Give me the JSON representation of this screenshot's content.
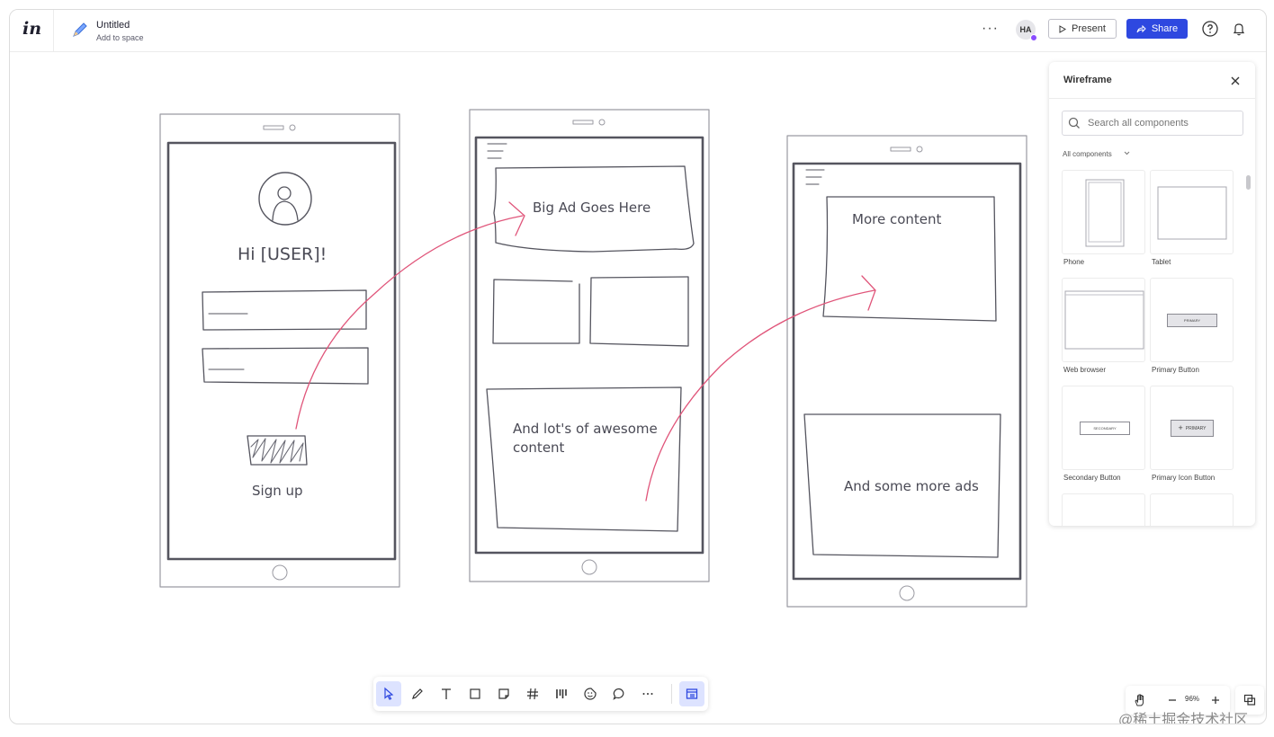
{
  "app": {
    "logo": "in",
    "doc_title": "Untitled",
    "doc_subtitle": "Add to space"
  },
  "header": {
    "more_label": "···",
    "avatar_initials": "HA",
    "present_label": "Present",
    "share_label": "Share"
  },
  "canvas": {
    "screen1": {
      "greeting": "Hi  [USER]!",
      "signup": "Sign up"
    },
    "screen2": {
      "ad": "Big Ad Goes Here",
      "content_line1": "And lot's of awesome",
      "content_line2": "content"
    },
    "screen3": {
      "more": "More content",
      "ads": "And some more ads"
    }
  },
  "panel": {
    "title": "Wireframe",
    "search_placeholder": "Search all components",
    "filter_label": "All components",
    "components": [
      {
        "label": "Phone"
      },
      {
        "label": "Tablet"
      },
      {
        "label": "Web browser"
      },
      {
        "label": "Primary Button",
        "preview_text": "PRIMARY"
      },
      {
        "label": "Secondary Button",
        "preview_text": "SECONDARY"
      },
      {
        "label": "Primary Icon Button",
        "preview_text": "PRIMARY"
      }
    ]
  },
  "zoom": {
    "value": "96%"
  },
  "watermark": "@稀土掘金技术社区",
  "colors": {
    "accent": "#2e48e0",
    "arrow": "#e0557a",
    "sketch": "#55555f",
    "active_tool": "#dde3ff"
  }
}
